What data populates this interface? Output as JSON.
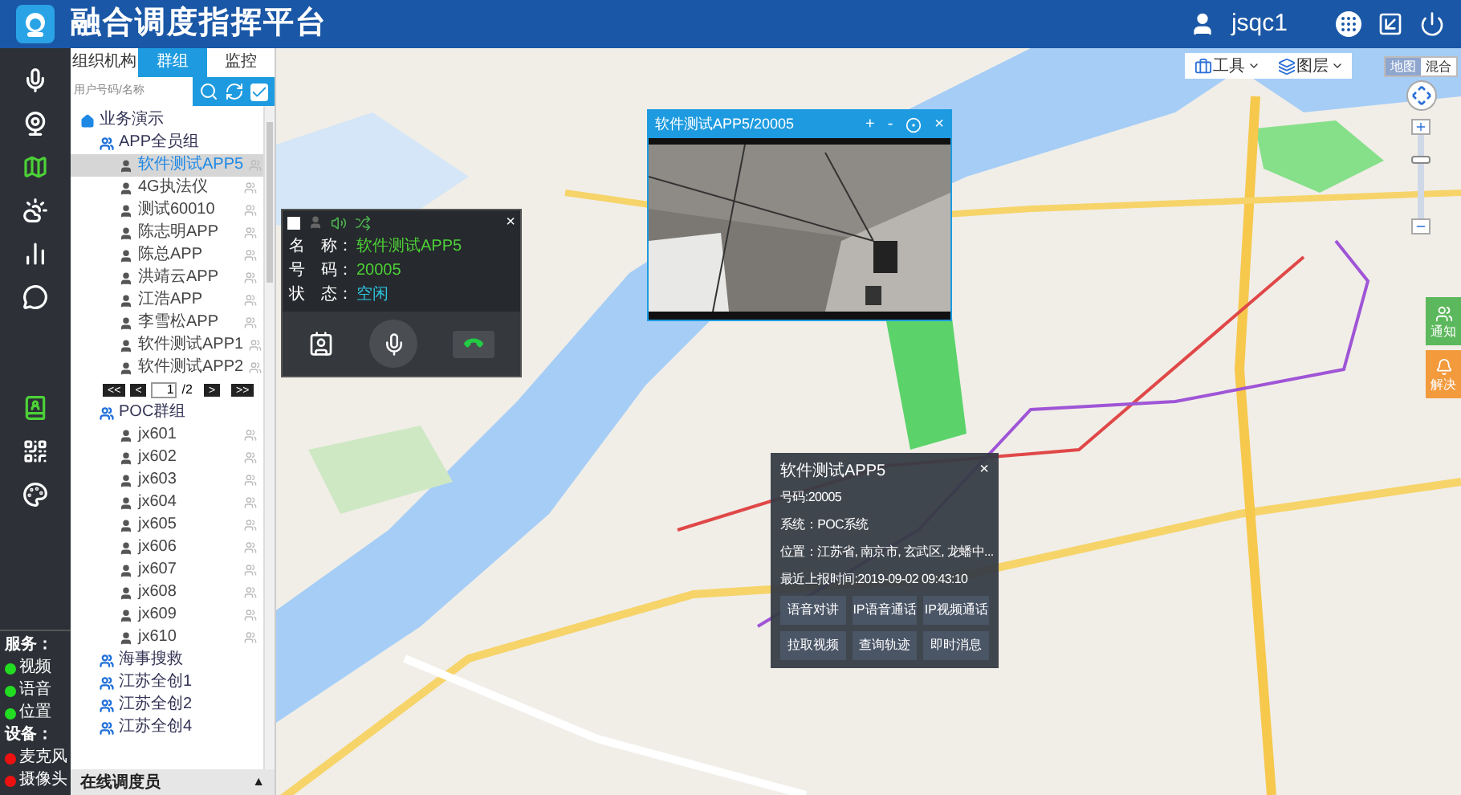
{
  "header": {
    "title": "融合调度指挥平台",
    "user": "jsqc1"
  },
  "nav": [
    {
      "selected": false
    },
    {
      "selected": false
    },
    {
      "selected": true
    },
    {
      "selected": false
    },
    {
      "selected": false
    },
    {
      "selected": false
    },
    {
      "selected": true
    },
    {
      "selected": false
    },
    {
      "selected": false
    }
  ],
  "status": [
    {
      "title": "服务：",
      "items": [
        {
          "label": "视频",
          "on": true
        },
        {
          "label": "语音",
          "on": true
        },
        {
          "label": "位置",
          "on": true
        }
      ]
    },
    {
      "title": "设备：",
      "items": [
        {
          "label": "麦克风",
          "on": false
        },
        {
          "label": "摄像头",
          "on": false
        }
      ]
    }
  ],
  "tabs": [
    {
      "label": "组织机构",
      "selected": false
    },
    {
      "label": "群组",
      "selected": true
    },
    {
      "label": "监控",
      "selected": false
    }
  ],
  "search": {
    "placeholder": "用户号码/名称"
  },
  "tree": [
    {
      "label": "业务演示",
      "kind": "org",
      "children": [
        {
          "label": "APP全员组",
          "kind": "group",
          "pager": {
            "first": "<<",
            "prev": "<",
            "page": "1",
            "total": "/2",
            "next": ">",
            "last": ">>"
          },
          "children": [
            {
              "label": "软件测试APP5",
              "kind": "user",
              "selected": true
            },
            {
              "label": "4G执法仪",
              "kind": "user",
              "selected": false
            },
            {
              "label": "测试60010",
              "kind": "user",
              "selected": false
            },
            {
              "label": "陈志明APP",
              "kind": "user",
              "selected": false
            },
            {
              "label": "陈总APP",
              "kind": "user",
              "selected": false
            },
            {
              "label": "洪靖云APP",
              "kind": "user",
              "selected": false
            },
            {
              "label": "江浩APP",
              "kind": "user",
              "selected": false
            },
            {
              "label": "李雪松APP",
              "kind": "user",
              "selected": false
            },
            {
              "label": "软件测试APP1",
              "kind": "user",
              "selected": false
            },
            {
              "label": "软件测试APP2",
              "kind": "user",
              "selected": false
            }
          ]
        },
        {
          "label": "POC群组",
          "kind": "group",
          "children": [
            {
              "label": "jx601",
              "kind": "user",
              "selected": false
            },
            {
              "label": "jx602",
              "kind": "user",
              "selected": false
            },
            {
              "label": "jx603",
              "kind": "user",
              "selected": false
            },
            {
              "label": "jx604",
              "kind": "user",
              "selected": false
            },
            {
              "label": "jx605",
              "kind": "user",
              "selected": false
            },
            {
              "label": "jx606",
              "kind": "user",
              "selected": false
            },
            {
              "label": "jx607",
              "kind": "user",
              "selected": false
            },
            {
              "label": "jx608",
              "kind": "user",
              "selected": false
            },
            {
              "label": "jx609",
              "kind": "user",
              "selected": false
            },
            {
              "label": "jx610",
              "kind": "user",
              "selected": false
            }
          ]
        },
        {
          "label": "海事搜救",
          "kind": "group"
        },
        {
          "label": "江苏全创1",
          "kind": "group"
        },
        {
          "label": "江苏全创2",
          "kind": "group"
        },
        {
          "label": "江苏全创4",
          "kind": "group"
        }
      ]
    }
  ],
  "bottom_bar": {
    "label": "在线调度员",
    "toggle": "▲"
  },
  "call_panel": {
    "checked": false,
    "close": "×",
    "fields": [
      {
        "label": "名　称：",
        "value": "软件测试APP5",
        "kind": "text"
      },
      {
        "label": "号　码：",
        "value": "20005",
        "kind": "text"
      },
      {
        "label": "状　态：",
        "value": "空闲",
        "kind": "status"
      }
    ]
  },
  "video": {
    "title": "软件测试APP5/20005",
    "zoom_in": "+",
    "zoom_out": "-",
    "close": "×"
  },
  "info_popup": {
    "title": "软件测试APP5",
    "close": "×",
    "lines": [
      "号码:20005",
      "系统：POC系统",
      "位置：江苏省, 南京市, 玄武区, 龙蟠中...",
      "最近上报时间:2019-09-02 09:43:10"
    ],
    "buttons": [
      "语音对讲",
      "IP语音通话",
      "IP视频通话",
      "拉取视频",
      "查询轨迹",
      "即时消息"
    ]
  },
  "map": {
    "tools": [
      {
        "label": "工具",
        "kind": "tools"
      },
      {
        "label": "图层",
        "kind": "layers"
      }
    ],
    "map_types": [
      {
        "label": "地图",
        "selected": true
      },
      {
        "label": "混合",
        "selected": false
      }
    ],
    "zoom": {
      "level": 0.72
    },
    "side_buttons": [
      {
        "label": "通知",
        "color": "#5cb85c",
        "kind": "notify"
      },
      {
        "label": "解决",
        "color": "#f39a3d",
        "kind": "alarm"
      }
    ]
  }
}
